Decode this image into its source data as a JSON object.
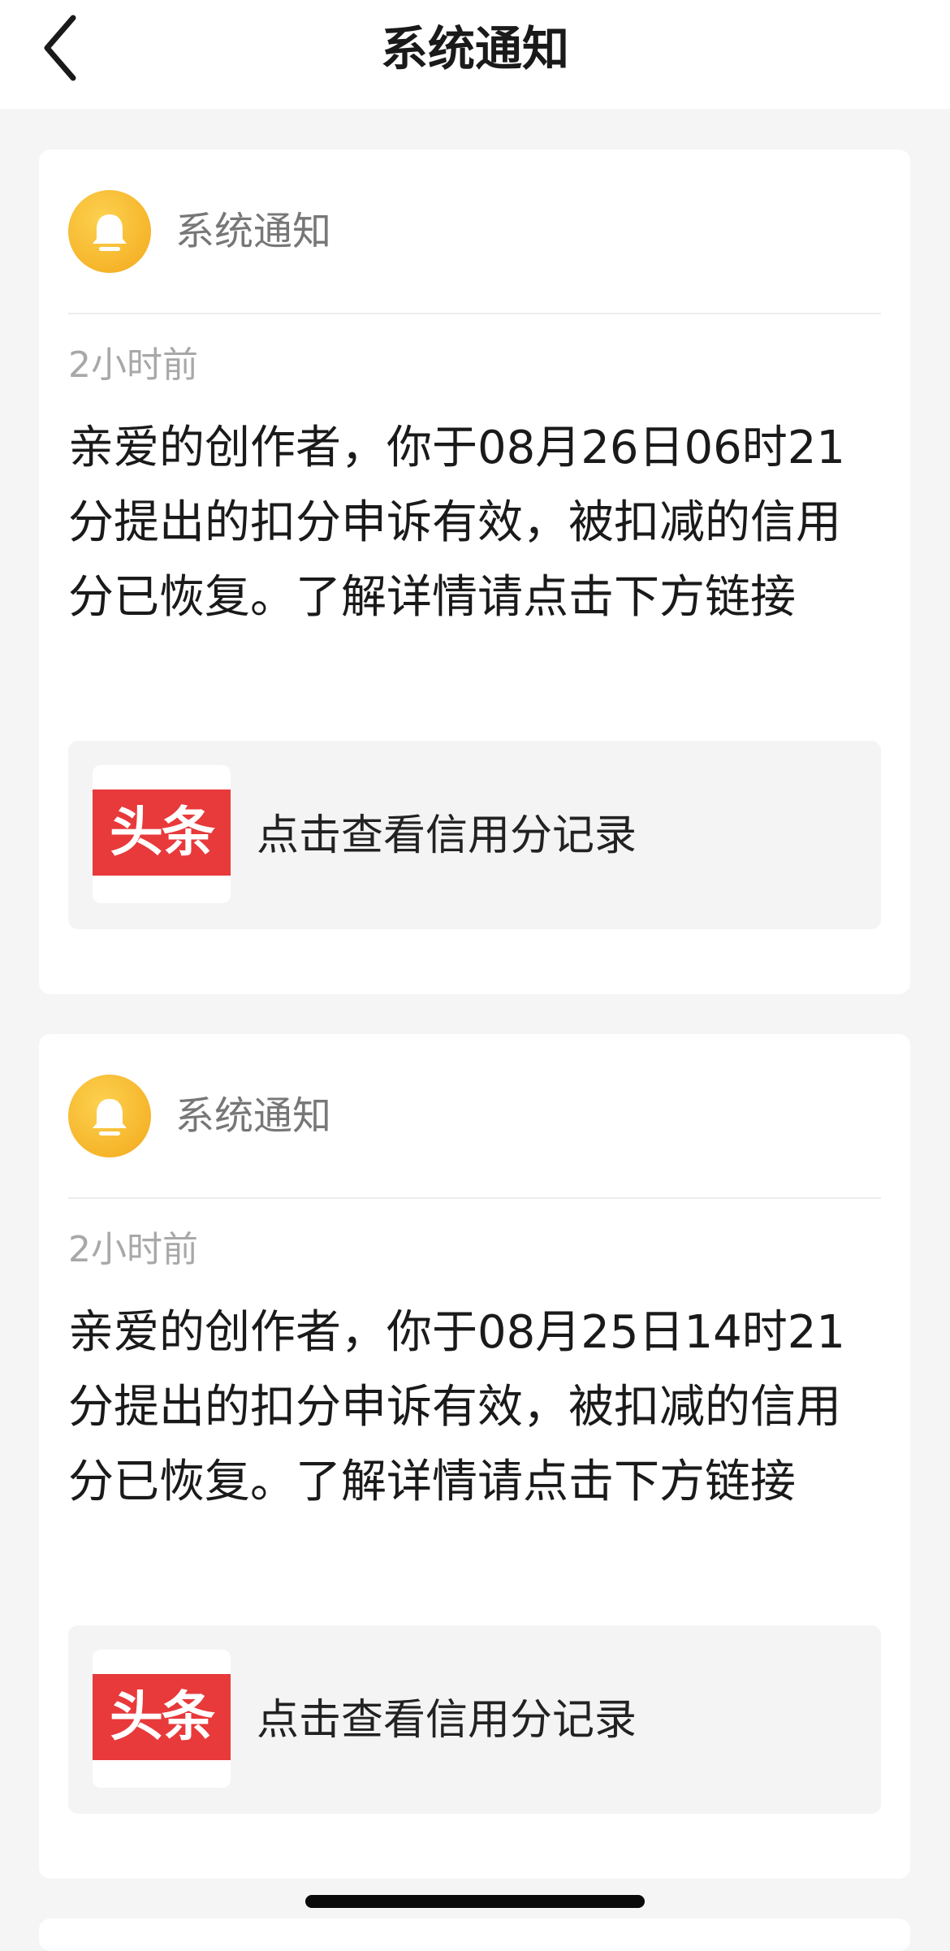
{
  "header": {
    "title": "系统通知",
    "back_icon": "chevron-left-icon"
  },
  "notifications": [
    {
      "sender": "系统通知",
      "avatar_icon": "bell-icon",
      "time": "2小时前",
      "message": "亲爱的创作者，你于08月26日06时21分提出的扣分申诉有效，被扣减的信用分已恢复。了解详情请点击下方链接",
      "link": {
        "logo_text": "头条",
        "label": "点击查看信用分记录"
      }
    },
    {
      "sender": "系统通知",
      "avatar_icon": "bell-icon",
      "time": "2小时前",
      "message": "亲爱的创作者，你于08月25日14时21分提出的扣分申诉有效，被扣减的信用分已恢复。了解详情请点击下方链接",
      "link": {
        "logo_text": "头条",
        "label": "点击查看信用分记录"
      }
    }
  ],
  "colors": {
    "avatar": "#f6b52b",
    "logo_red": "#e8393b",
    "page_bg": "#f5f5f5"
  }
}
